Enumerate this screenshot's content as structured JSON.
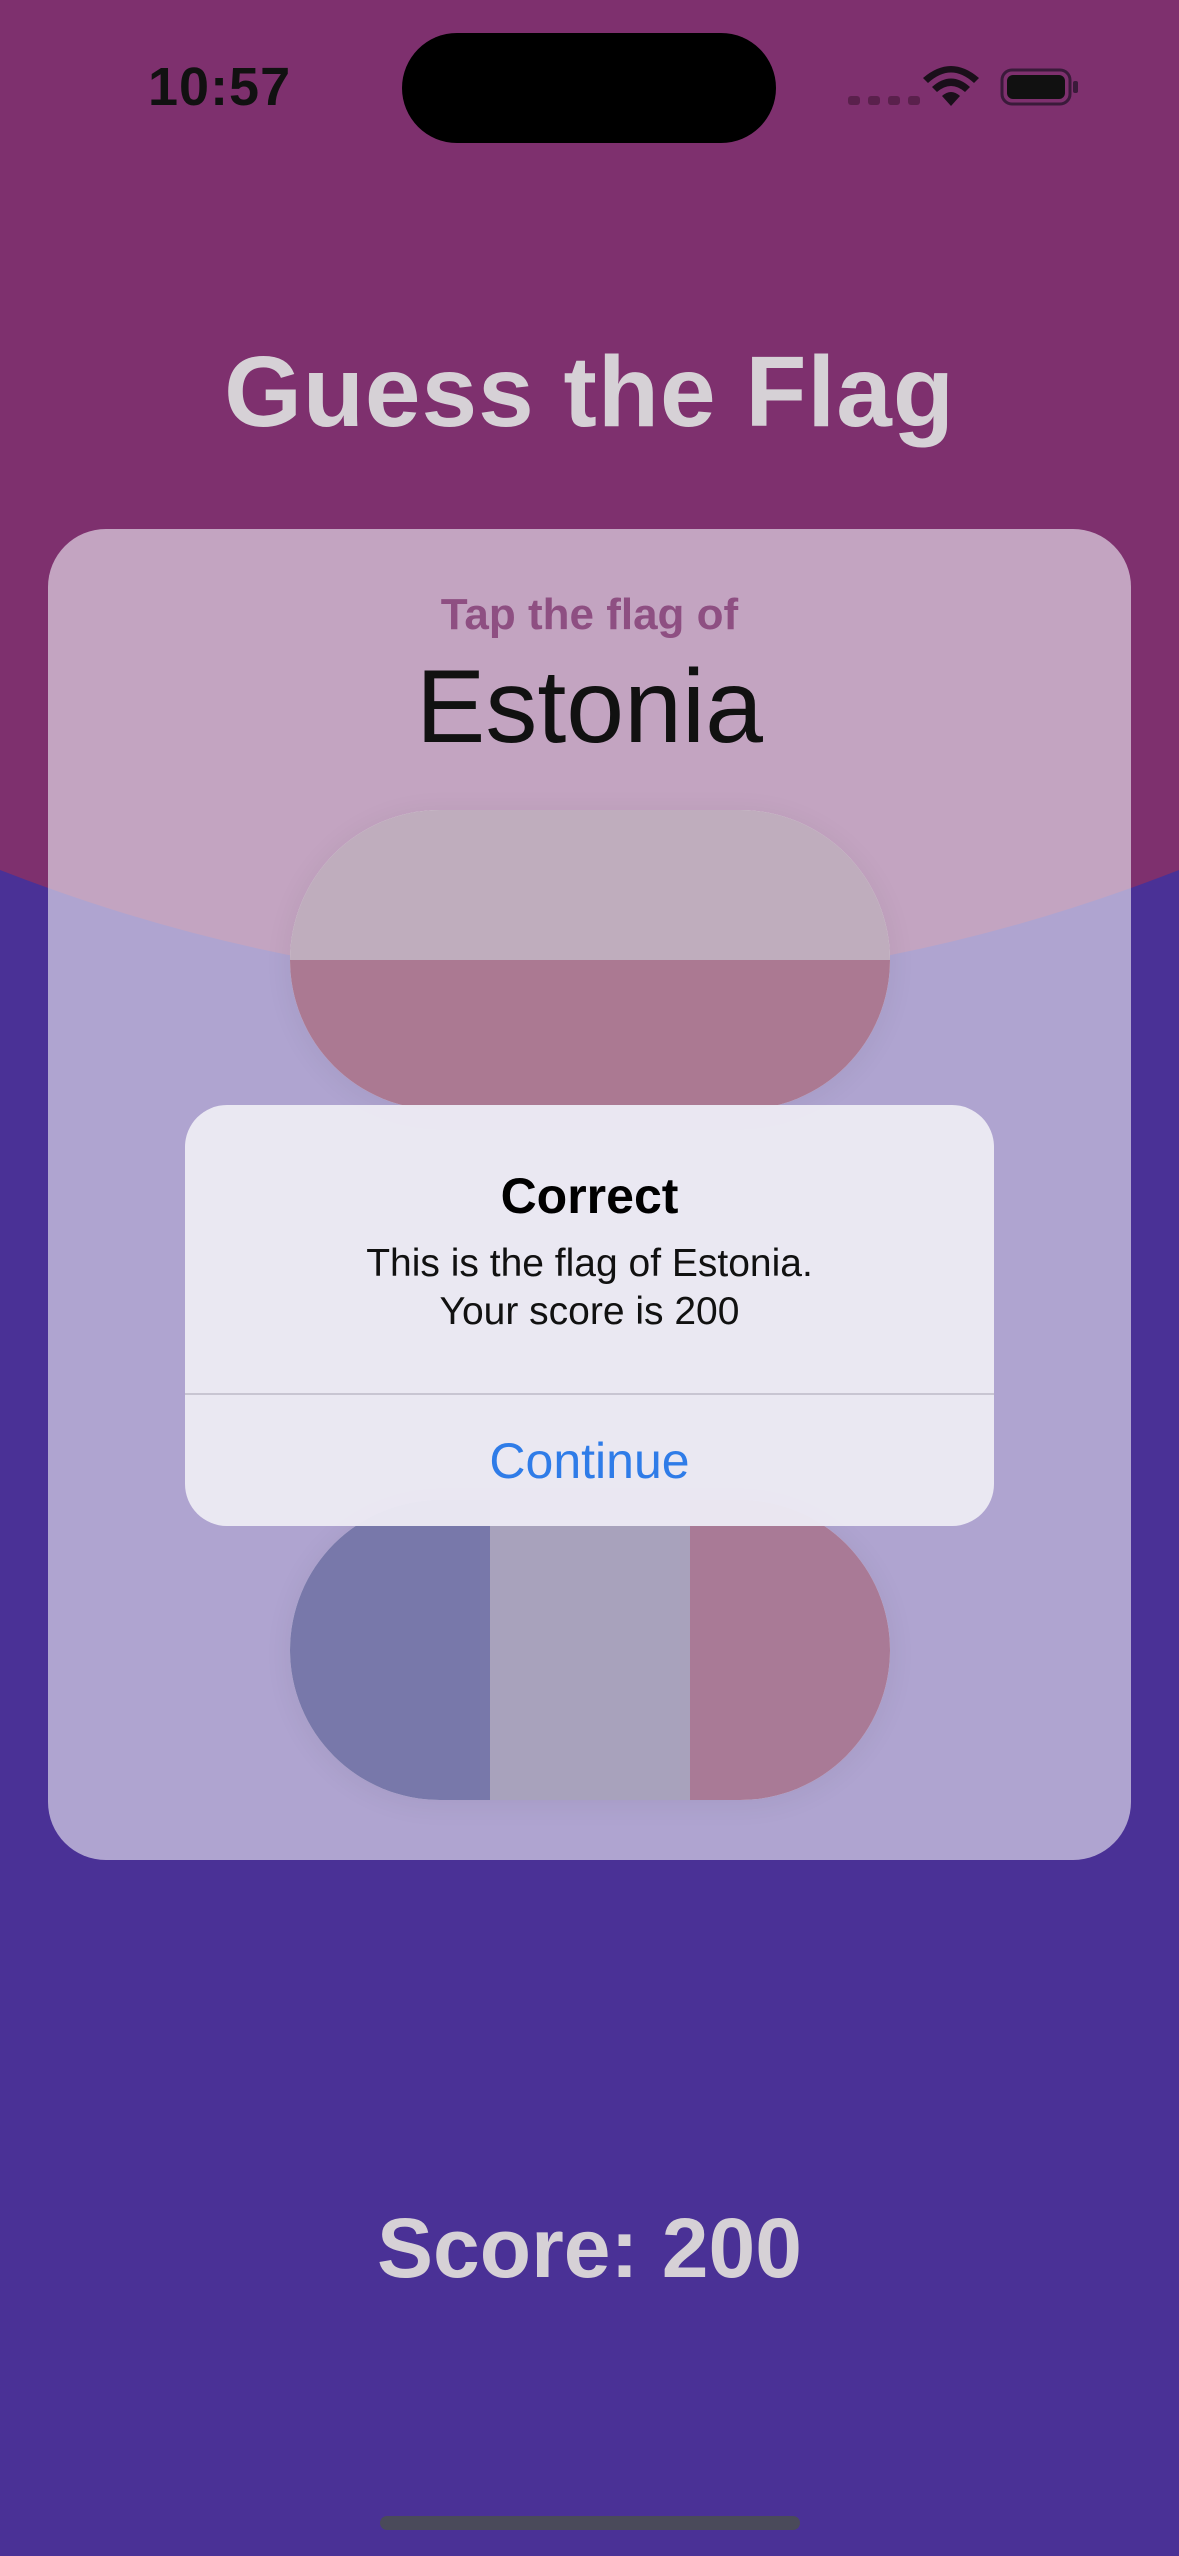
{
  "status_bar": {
    "time": "10:57"
  },
  "header": {
    "title": "Guess the Flag"
  },
  "card": {
    "subtitle": "Tap the flag of",
    "country": "Estonia"
  },
  "flags": [
    {
      "name": "flag-option-1",
      "colors": [
        "#bfadbd",
        "#ab7992"
      ]
    },
    {
      "name": "flag-option-3",
      "colors": [
        "#7878aa",
        "#a8a2bc",
        "#a97a96"
      ]
    }
  ],
  "alert": {
    "title": "Correct",
    "message_line_1": "This is the flag of Estonia.",
    "message_line_2": "Your score is 200",
    "button_label": "Continue"
  },
  "footer": {
    "score_text": "Score: 200"
  },
  "colors": {
    "top_gradient": "#7e306e",
    "bottom_gradient": "#4a3196",
    "accent": "#2f7ce8"
  }
}
